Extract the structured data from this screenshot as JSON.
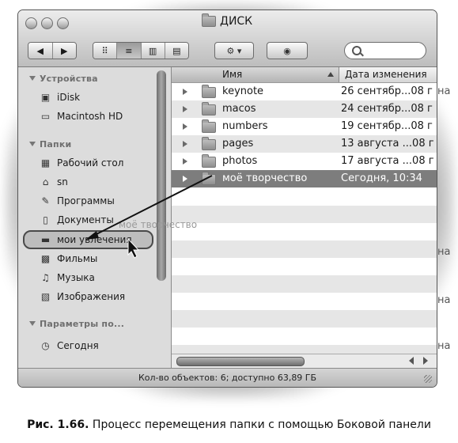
{
  "window": {
    "title": "ДИСК",
    "toolbar": {
      "back_icon": "◀",
      "forward_icon": "▶",
      "view_icon_mode": "⠿",
      "view_list_mode": "≡",
      "view_columns_mode": "▥",
      "view_coverflow_mode": "▤",
      "action_icon": "⚙ ▾",
      "quicklook_icon": "◉"
    }
  },
  "sidebar": {
    "sections": [
      {
        "heading": "Устройства"
      },
      {
        "heading": "Папки"
      },
      {
        "heading": "Параметры по..."
      }
    ],
    "devices": [
      {
        "label": "iDisk",
        "icon": "idisk-icon"
      },
      {
        "label": "Macintosh HD",
        "icon": "hard-disk-icon"
      }
    ],
    "folders": [
      {
        "label": "Рабочий стол",
        "icon": "desktop-icon"
      },
      {
        "label": "sn",
        "icon": "home-icon"
      },
      {
        "label": "Программы",
        "icon": "applications-icon"
      },
      {
        "label": "Документы",
        "icon": "documents-icon"
      },
      {
        "label": "мои увлечения",
        "icon": "folder-icon"
      },
      {
        "label": "Фильмы",
        "icon": "movies-icon"
      },
      {
        "label": "Музыка",
        "icon": "music-icon"
      },
      {
        "label": "Изображения",
        "icon": "pictures-icon"
      }
    ],
    "search_params": [
      {
        "label": "Сегодня",
        "icon": "clock-icon"
      }
    ],
    "drag_ghost": "моё творчество"
  },
  "list": {
    "columns": {
      "name": "Имя",
      "date": "Дата изменения"
    },
    "rows": [
      {
        "name": "keynote",
        "date": "26 сентябр...08 г"
      },
      {
        "name": "macos",
        "date": "24 сентябр...08 г"
      },
      {
        "name": "numbers",
        "date": "19 сентябр...08 г"
      },
      {
        "name": "pages",
        "date": "13 августа ...08 г"
      },
      {
        "name": "photos",
        "date": "17 августа ...08 г"
      },
      {
        "name": "моё творчество",
        "date": "Сегодня, 10:34"
      }
    ]
  },
  "status": {
    "text": "Кол-во объектов: 6; доступно 63,89 ГБ"
  },
  "margin_fragments": [
    "на",
    "на",
    "на",
    "на"
  ],
  "caption": {
    "label": "Рис. 1.66.",
    "text": " Процесс перемещения папки с помощью Боковой панели"
  }
}
